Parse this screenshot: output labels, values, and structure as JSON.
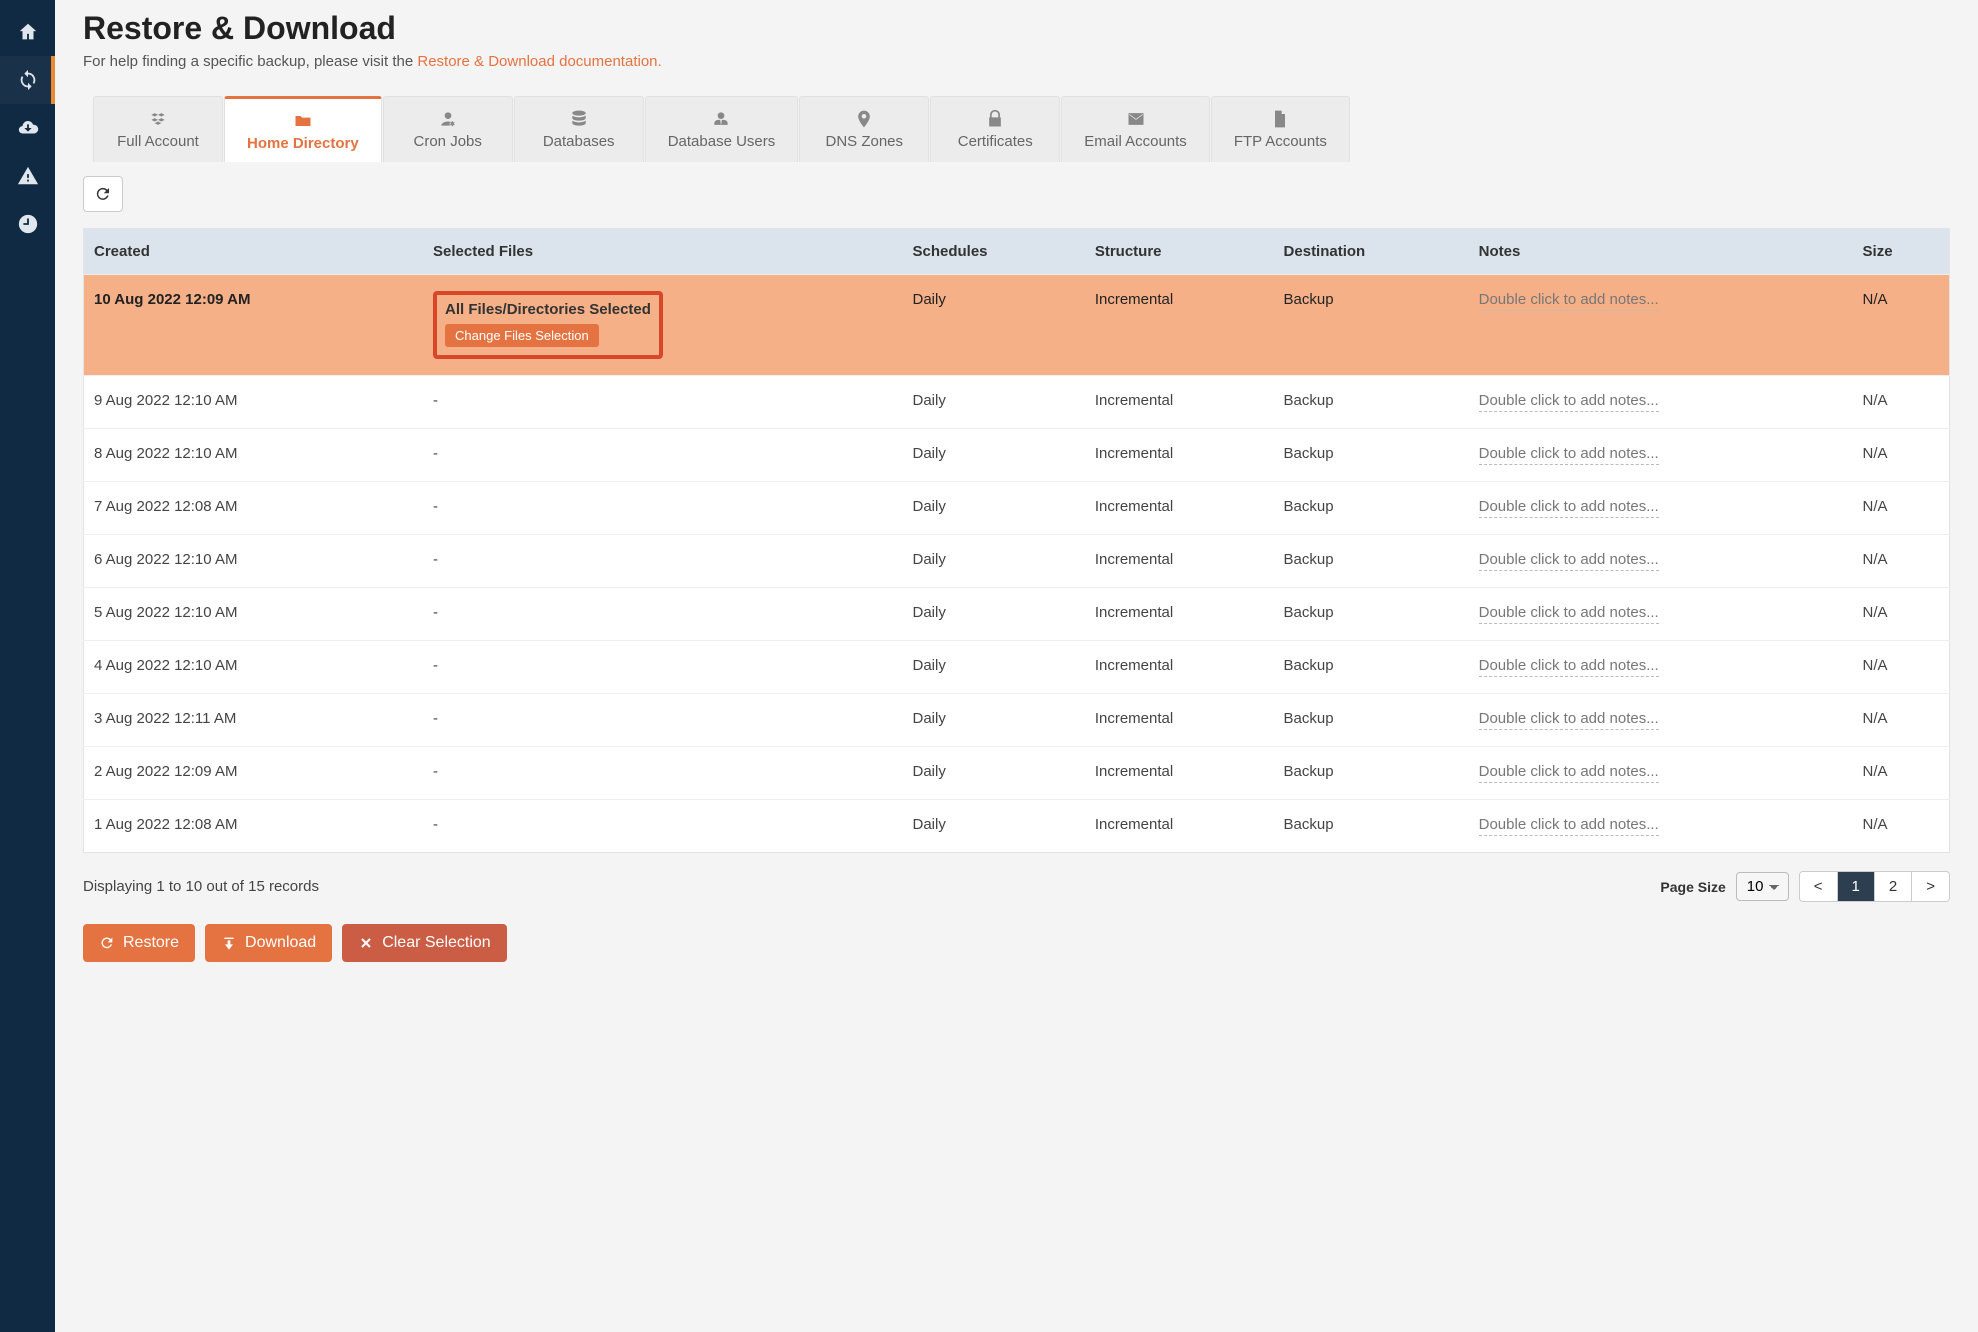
{
  "header": {
    "title": "Restore & Download",
    "help_prefix": "For help finding a specific backup, please visit the ",
    "help_link": "Restore & Download documentation."
  },
  "sidebar": {
    "items": [
      {
        "name": "home-icon"
      },
      {
        "name": "sync-icon",
        "active": true
      },
      {
        "name": "cloud-download-icon"
      },
      {
        "name": "alert-icon"
      },
      {
        "name": "clock-icon"
      }
    ]
  },
  "tabs": [
    {
      "label": "Full Account",
      "icon": "cubes"
    },
    {
      "label": "Home Directory",
      "icon": "folder",
      "active": true
    },
    {
      "label": "Cron Jobs",
      "icon": "user-gear"
    },
    {
      "label": "Databases",
      "icon": "database"
    },
    {
      "label": "Database Users",
      "icon": "user-tie"
    },
    {
      "label": "DNS Zones",
      "icon": "map-pin"
    },
    {
      "label": "Certificates",
      "icon": "lock"
    },
    {
      "label": "Email Accounts",
      "icon": "envelope"
    },
    {
      "label": "FTP Accounts",
      "icon": "file"
    }
  ],
  "table": {
    "headers": [
      "Created",
      "Selected Files",
      "Schedules",
      "Structure",
      "Destination",
      "Notes",
      "Size"
    ],
    "notes_placeholder": "Double click to add notes...",
    "selected_files_title": "All Files/Directories Selected",
    "change_files_label": "Change Files Selection",
    "rows": [
      {
        "created": "10 Aug 2022 12:09 AM",
        "selected": true,
        "schedules": "Daily",
        "structure": "Incremental",
        "destination": "Backup",
        "size": "N/A"
      },
      {
        "created": "9 Aug 2022 12:10 AM",
        "files": "-",
        "schedules": "Daily",
        "structure": "Incremental",
        "destination": "Backup",
        "size": "N/A"
      },
      {
        "created": "8 Aug 2022 12:10 AM",
        "files": "-",
        "schedules": "Daily",
        "structure": "Incremental",
        "destination": "Backup",
        "size": "N/A"
      },
      {
        "created": "7 Aug 2022 12:08 AM",
        "files": "-",
        "schedules": "Daily",
        "structure": "Incremental",
        "destination": "Backup",
        "size": "N/A"
      },
      {
        "created": "6 Aug 2022 12:10 AM",
        "files": "-",
        "schedules": "Daily",
        "structure": "Incremental",
        "destination": "Backup",
        "size": "N/A"
      },
      {
        "created": "5 Aug 2022 12:10 AM",
        "files": "-",
        "schedules": "Daily",
        "structure": "Incremental",
        "destination": "Backup",
        "size": "N/A"
      },
      {
        "created": "4 Aug 2022 12:10 AM",
        "files": "-",
        "schedules": "Daily",
        "structure": "Incremental",
        "destination": "Backup",
        "size": "N/A"
      },
      {
        "created": "3 Aug 2022 12:11 AM",
        "files": "-",
        "schedules": "Daily",
        "structure": "Incremental",
        "destination": "Backup",
        "size": "N/A"
      },
      {
        "created": "2 Aug 2022 12:09 AM",
        "files": "-",
        "schedules": "Daily",
        "structure": "Incremental",
        "destination": "Backup",
        "size": "N/A"
      },
      {
        "created": "1 Aug 2022 12:08 AM",
        "files": "-",
        "schedules": "Daily",
        "structure": "Incremental",
        "destination": "Backup",
        "size": "N/A"
      }
    ]
  },
  "footer": {
    "record_count": "Displaying 1 to 10 out of 15 records",
    "page_size_label": "Page Size",
    "page_size_value": "10",
    "pages": [
      "<",
      "1",
      "2",
      ">"
    ],
    "active_page": "1"
  },
  "actions": {
    "restore": "Restore",
    "download": "Download",
    "clear": "Clear Selection"
  }
}
